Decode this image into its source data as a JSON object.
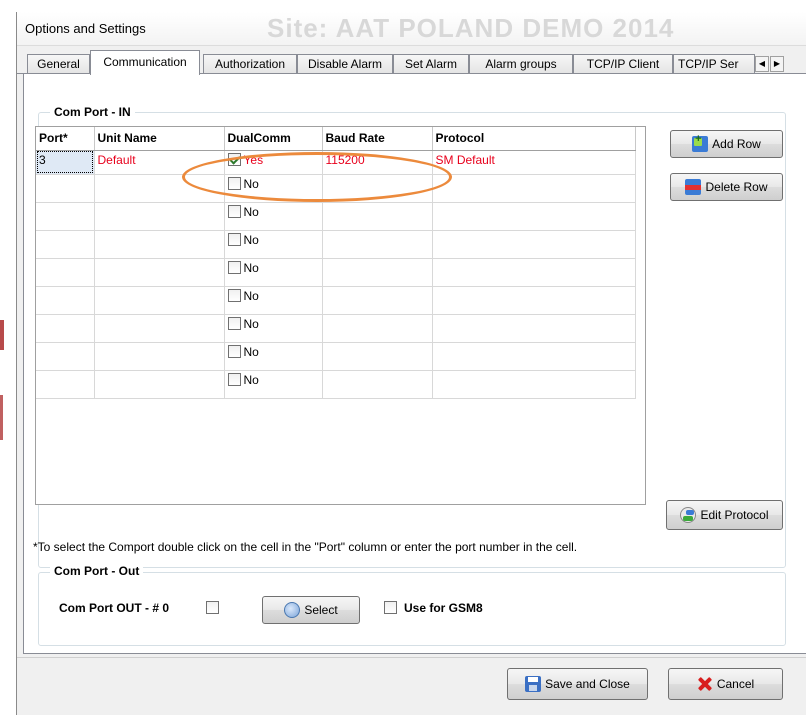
{
  "window": {
    "title": "Options and Settings",
    "background_title": "Site: AAT POLAND DEMO 2014"
  },
  "tabs": [
    {
      "label": "General",
      "active": false
    },
    {
      "label": "Communication",
      "active": true
    },
    {
      "label": "Authorization",
      "active": false
    },
    {
      "label": "Disable Alarm",
      "active": false
    },
    {
      "label": "Set Alarm",
      "active": false
    },
    {
      "label": "Alarm groups",
      "active": false
    },
    {
      "label": "TCP/IP Client",
      "active": false
    },
    {
      "label": "TCP/IP Ser",
      "active": false
    }
  ],
  "tab_scroll": {
    "left": "◀",
    "right": "▶"
  },
  "com_in": {
    "title": "Com Port - IN",
    "columns": [
      "Port*",
      "Unit Name",
      "DualComm",
      "Baud Rate",
      "Protocol"
    ],
    "rows": [
      {
        "port": "3",
        "unit": "Default",
        "dual": true,
        "dual_label": "Yes",
        "baud": "115200",
        "protocol": "SM Default"
      },
      {
        "port": "",
        "unit": "",
        "dual": false,
        "dual_label": "No",
        "baud": "",
        "protocol": ""
      },
      {
        "port": "",
        "unit": "",
        "dual": false,
        "dual_label": "No",
        "baud": "",
        "protocol": ""
      },
      {
        "port": "",
        "unit": "",
        "dual": false,
        "dual_label": "No",
        "baud": "",
        "protocol": ""
      },
      {
        "port": "",
        "unit": "",
        "dual": false,
        "dual_label": "No",
        "baud": "",
        "protocol": ""
      },
      {
        "port": "",
        "unit": "",
        "dual": false,
        "dual_label": "No",
        "baud": "",
        "protocol": ""
      },
      {
        "port": "",
        "unit": "",
        "dual": false,
        "dual_label": "No",
        "baud": "",
        "protocol": ""
      },
      {
        "port": "",
        "unit": "",
        "dual": false,
        "dual_label": "No",
        "baud": "",
        "protocol": ""
      },
      {
        "port": "",
        "unit": "",
        "dual": false,
        "dual_label": "No",
        "baud": "",
        "protocol": ""
      }
    ],
    "add_row_label": "Add Row",
    "delete_row_label": "Delete Row",
    "edit_protocol_label": "Edit Protocol",
    "note": "*To select the Comport double click on the cell in the \"Port\" column or enter the port number in the cell."
  },
  "com_out": {
    "title": "Com Port - Out",
    "port_label": "Com Port OUT - # 0",
    "port_checked": false,
    "select_label": "Select",
    "gsm_label": "Use for GSM8",
    "gsm_checked": false
  },
  "footer": {
    "save_label": "Save and Close",
    "cancel_label": "Cancel"
  },
  "colors": {
    "accent_red": "#e8001c",
    "annotation_orange": "#ec8a3c"
  }
}
